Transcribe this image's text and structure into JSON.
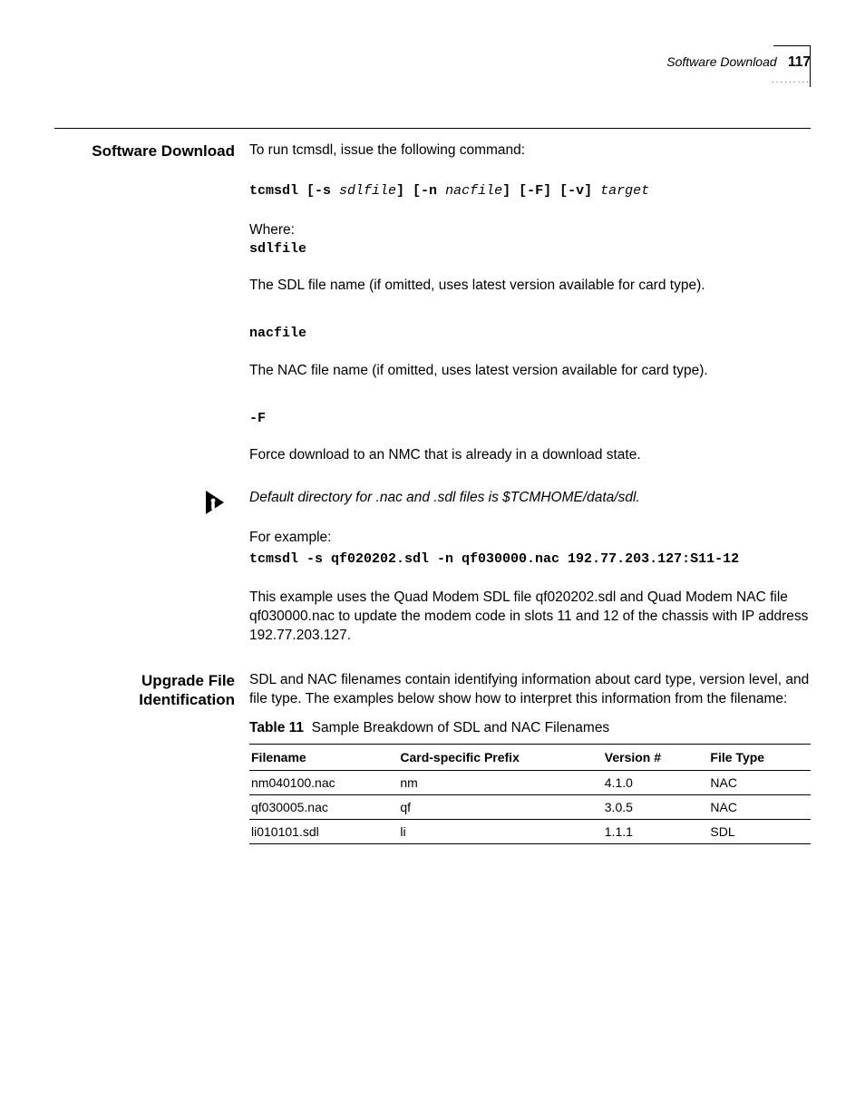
{
  "header": {
    "breadcrumb": "Software Download",
    "page_number": "117",
    "dots": "........."
  },
  "section1": {
    "title": "Software Download",
    "intro": "To run tcmsdl, issue the following command:",
    "cmd_prefix": "tcmsdl [-s ",
    "cmd_arg1": "sdlfile",
    "cmd_mid1": "] [-n ",
    "cmd_arg2": "nacfile",
    "cmd_mid2": "] [-F] [-v] ",
    "cmd_arg3": "target",
    "where": "Where:",
    "p_sdl_name": "sdlfile",
    "p_sdl_desc": "The SDL file name (if omitted, uses latest version available for card type).",
    "p_nac_name": "nacfile",
    "p_nac_desc": "The NAC file name (if omitted, uses latest version available for card type).",
    "p_f_name": "-F",
    "p_f_desc": "Force download to an NMC that is already in a download state.",
    "note": "Default directory for .nac and .sdl files is $TCMHOME/data/sdl.",
    "for_example": "For example:",
    "example_cmd": "tcmsdl -s qf020202.sdl -n qf030000.nac 192.77.203.127:S11-12",
    "example_desc": "This example uses the Quad Modem SDL file qf020202.sdl and Quad Modem NAC file qf030000.nac to update the modem code in slots 11 and 12 of the chassis with IP address 192.77.203.127."
  },
  "section2": {
    "title_l1": "Upgrade File",
    "title_l2": "Identification",
    "intro": "SDL and NAC filenames contain identifying information about card type, version level, and file type. The examples below show how to interpret this information from the filename:",
    "table_label": "Table 11",
    "table_caption": "Sample Breakdown of SDL and NAC Filenames",
    "cols": [
      "Filename",
      "Card-specific Prefix",
      "Version #",
      "File Type"
    ],
    "rows": [
      [
        "nm040100.nac",
        "nm",
        "4.1.0",
        "NAC"
      ],
      [
        "qf030005.nac",
        "qf",
        "3.0.5",
        "NAC"
      ],
      [
        "li010101.sdl",
        "li",
        "1.1.1",
        "SDL"
      ]
    ]
  }
}
